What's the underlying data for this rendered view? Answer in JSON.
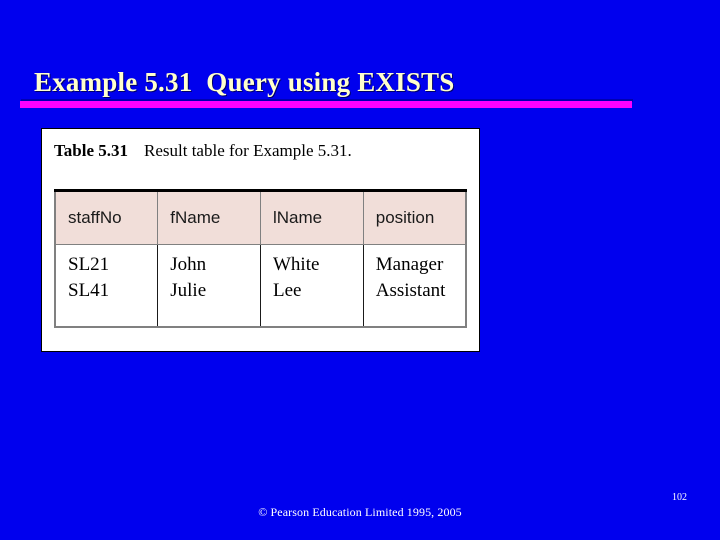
{
  "slide": {
    "background_color": "#0000EE",
    "title": "Example 5.31  Query using EXISTS",
    "title_color": "#FFFFCC",
    "rule_color": "#FF00FF"
  },
  "table_panel": {
    "caption_label": "Table 5.31",
    "caption_text": "Result table for Example 5.31.",
    "header_background": "#F1DED9",
    "columns": [
      {
        "header": "staffNo"
      },
      {
        "header": "fName"
      },
      {
        "header": "lName"
      },
      {
        "header": "position"
      }
    ],
    "cells": [
      {
        "lines": [
          "SL21",
          "SL41"
        ]
      },
      {
        "lines": [
          "John",
          "Julie"
        ]
      },
      {
        "lines": [
          "White",
          "Lee"
        ]
      },
      {
        "lines": [
          "Manager",
          "Assistant"
        ]
      }
    ]
  },
  "footer": {
    "copyright": "© Pearson Education Limited 1995, 2005",
    "page_number": "102"
  }
}
